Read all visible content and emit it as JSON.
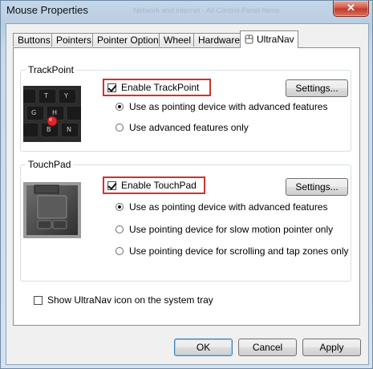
{
  "window": {
    "title": "Mouse Properties",
    "close_glyph": "✕",
    "background_hint": "Network and Internet  ·  All Control Panel Items"
  },
  "tabs": [
    {
      "label": "Buttons",
      "active": false
    },
    {
      "label": "Pointers",
      "active": false
    },
    {
      "label": "Pointer Options",
      "active": false
    },
    {
      "label": "Wheel",
      "active": false
    },
    {
      "label": "Hardware",
      "active": false
    },
    {
      "label": "UltraNav",
      "active": true
    }
  ],
  "trackpoint": {
    "group_label": "TrackPoint",
    "enable_label": "Enable TrackPoint",
    "enabled": true,
    "settings_label": "Settings...",
    "options": [
      {
        "label": "Use as pointing device with advanced features",
        "selected": true
      },
      {
        "label": "Use advanced features only",
        "selected": false
      }
    ]
  },
  "touchpad": {
    "group_label": "TouchPad",
    "enable_label": "Enable TouchPad",
    "enabled": true,
    "settings_label": "Settings...",
    "options": [
      {
        "label": "Use as pointing device with advanced features",
        "selected": true
      },
      {
        "label": "Use pointing device for slow motion pointer only",
        "selected": false
      },
      {
        "label": "Use pointing device for scrolling and tap zones only",
        "selected": false
      }
    ]
  },
  "tray_option": {
    "label": "Show UltraNav icon on the system tray",
    "checked": false
  },
  "footer": {
    "ok_label": "OK",
    "cancel_label": "Cancel",
    "apply_label": "Apply"
  },
  "colors": {
    "highlight_border": "#d32f2f",
    "trackpoint_red": "#e0262b",
    "default_button_border": "#3c7fb1"
  },
  "icons": {
    "close": "close-icon",
    "ultranav_tab": "ultranav-tab-icon",
    "trackpoint_image": "trackpoint-keyboard-image",
    "touchpad_image": "touchpad-image"
  }
}
